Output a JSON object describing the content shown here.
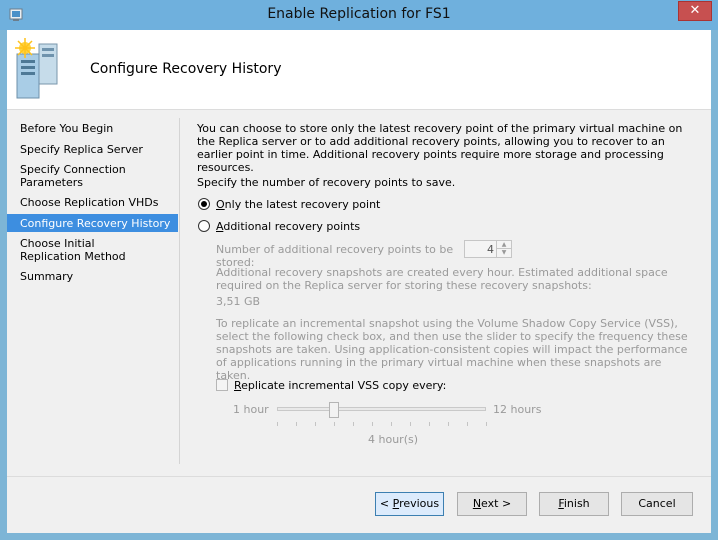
{
  "window": {
    "title": "Enable Replication for FS1",
    "close_glyph": "✕"
  },
  "header": {
    "title": "Configure Recovery History",
    "icon": "server-replication-icon"
  },
  "sidebar": {
    "items": [
      {
        "label": "Before You Begin",
        "selected": false
      },
      {
        "label": "Specify Replica Server",
        "selected": false
      },
      {
        "label": "Specify Connection Parameters",
        "selected": false
      },
      {
        "label": "Choose Replication VHDs",
        "selected": false
      },
      {
        "label": "Configure Recovery History",
        "selected": true
      },
      {
        "label": "Choose Initial Replication Method",
        "selected": false
      },
      {
        "label": "Summary",
        "selected": false
      }
    ]
  },
  "main": {
    "intro": "You can choose to store only the latest recovery point of the primary virtual machine on the Replica server or to add additional recovery points, allowing you to recover to an earlier point in time. Additional recovery points require more storage and processing resources.",
    "prompt": "Specify the number of recovery points to save.",
    "radio_latest": {
      "label_prefix": "",
      "label_key": "O",
      "label_rest": "nly the latest recovery point",
      "checked": true
    },
    "radio_additional": {
      "label_prefix": "",
      "label_key": "A",
      "label_rest": "dditional recovery points",
      "checked": false
    },
    "additional_count_label": "Number of additional recovery points to be stored:",
    "additional_count_value": "4",
    "snapshots_info": "Additional recovery snapshots are created every hour. Estimated additional space required on the Replica server for storing these recovery snapshots:",
    "estimated_space": "3,51 GB",
    "vss_info": "To replicate an incremental snapshot using the Volume Shadow Copy Service (VSS), select the following check box, and then use the slider to specify the frequency these snapshots are taken. Using application-consistent copies will impact the performance of applications running in the primary virtual machine when these snapshots are taken.",
    "vss_checkbox": {
      "label_prefix": "",
      "label_key": "R",
      "label_rest": "eplicate incremental VSS copy every:",
      "checked": false
    },
    "slider": {
      "min_label": "1 hour",
      "max_label": "12 hours",
      "value_label": "4 hour(s)",
      "min": 1,
      "max": 12,
      "value": 4
    }
  },
  "footer": {
    "previous": {
      "prefix": "< ",
      "key": "P",
      "rest": "revious"
    },
    "next": {
      "prefix": "",
      "key": "N",
      "rest": "ext >"
    },
    "finish": {
      "prefix": "",
      "key": "F",
      "rest": "inish"
    },
    "cancel": "Cancel"
  },
  "colors": {
    "title_bar": "#6fb0dd",
    "close_button": "#c75050",
    "selection": "#3d8ee0",
    "default_button": "#dcebfc"
  }
}
